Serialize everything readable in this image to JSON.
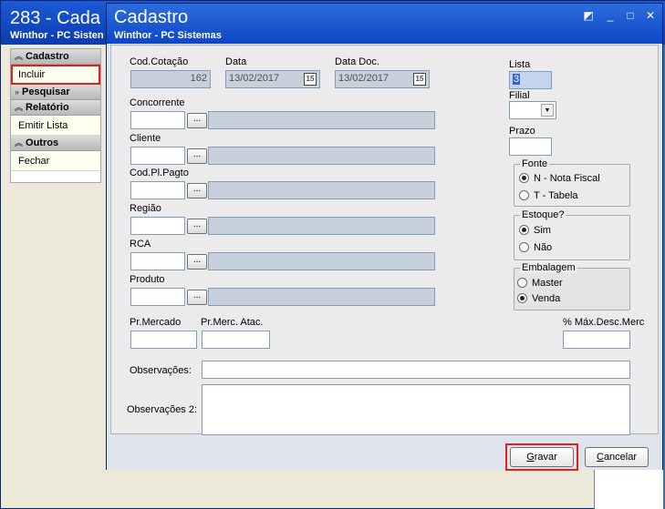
{
  "bg_window": {
    "title": "283 - Cada",
    "subtitle": "Winthor - PC Sisten"
  },
  "sidebar": {
    "sections": [
      {
        "label": "Cadastro",
        "items": [
          "Incluir"
        ]
      },
      {
        "label": "Pesquisar",
        "items": []
      },
      {
        "label": "Relatório",
        "items": [
          "Emitir Lista"
        ]
      },
      {
        "label": "Outros",
        "items": [
          "Fechar"
        ]
      }
    ]
  },
  "dialog": {
    "title": "Cadastro",
    "subtitle": "Winthor - PC Sistemas",
    "fields": {
      "cod_cotacao": {
        "label": "Cod.Cotação",
        "value": "162"
      },
      "data": {
        "label": "Data",
        "value": "13/02/2017"
      },
      "data_doc": {
        "label": "Data Doc.",
        "value": "13/02/2017"
      },
      "concorrente": {
        "label": "Concorrente"
      },
      "cliente": {
        "label": "Cliente"
      },
      "cod_pl_pagto": {
        "label": "Cod.Pl.Pagto"
      },
      "regiao": {
        "label": "Região"
      },
      "rca": {
        "label": "RCA"
      },
      "produto": {
        "label": "Produto"
      },
      "lista": {
        "label": "Lista",
        "value": "3"
      },
      "filial": {
        "label": "Filial"
      },
      "prazo": {
        "label": "Prazo"
      },
      "pr_mercado": {
        "label": "Pr.Mercado"
      },
      "pr_merc_atac": {
        "label": "Pr.Merc. Atac."
      },
      "max_desc_merc": {
        "label": "% Máx.Desc.Merc"
      },
      "observacoes": {
        "label": "Observações:"
      },
      "observacoes2": {
        "label": "Observações 2:"
      }
    },
    "calendar_glyph": "15",
    "ellipsis_glyph": "...",
    "fonte": {
      "title": "Fonte",
      "options": [
        "N - Nota Fiscal",
        "T - Tabela"
      ]
    },
    "estoque": {
      "title": "Estoque?",
      "options": [
        "Sim",
        "Não"
      ]
    },
    "embalagem": {
      "title": "Embalagem",
      "options": [
        "Master",
        "Venda"
      ]
    },
    "buttons": {
      "gravar": {
        "hotkey": "G",
        "rest": "ravar"
      },
      "cancelar": {
        "hotkey": "C",
        "rest": "ancelar"
      }
    }
  },
  "colors": {
    "titlebar": "#0d46c4",
    "highlight": "#e0201c",
    "readonly_field": "#c8d0dc"
  }
}
